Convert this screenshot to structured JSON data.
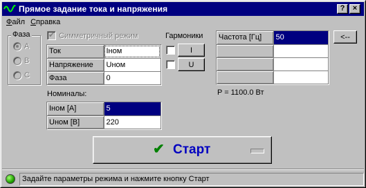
{
  "window": {
    "title": "Прямое задание тока и напряжения",
    "help_button": "?",
    "close_button": "×"
  },
  "menu": {
    "file_first": "Ф",
    "file_rest": "айл",
    "help_first": "С",
    "help_rest": "правка"
  },
  "phase_group": {
    "label": "Фаза",
    "options": [
      "A",
      "B",
      "C"
    ],
    "selected": "A",
    "enabled": false
  },
  "symmetric_mode": {
    "label": "Симметричный режим",
    "checked": true,
    "enabled": false
  },
  "params_table": {
    "rows": [
      {
        "name": "Ток",
        "value": "Iном"
      },
      {
        "name": "Напряжение",
        "value": "Uном"
      },
      {
        "name": "Фаза",
        "value": "0"
      }
    ]
  },
  "harmonics": {
    "label": "Гармоники",
    "buttons": [
      {
        "label": "I",
        "checked": false
      },
      {
        "label": "U",
        "checked": false
      }
    ]
  },
  "freq_table": {
    "header": "Частота [Гц]",
    "value": "50",
    "empty_rows": 3
  },
  "arrow_button": "<--",
  "power_text": "P = 1100.0 Вт",
  "nominals": {
    "label": "Номиналы:",
    "rows": [
      {
        "name": "Iном [A]",
        "value": "5"
      },
      {
        "name": "Uном [B]",
        "value": "220"
      }
    ]
  },
  "start_button": {
    "icon": "check-icon",
    "label": "Старт"
  },
  "status": {
    "text": "Задайте параметры режима и нажмите кнопку Старт",
    "led_color": "#20a000"
  },
  "colors": {
    "title_bar": "#000080",
    "selection": "#000080",
    "start_text": "#0000c0",
    "check": "#008000"
  }
}
